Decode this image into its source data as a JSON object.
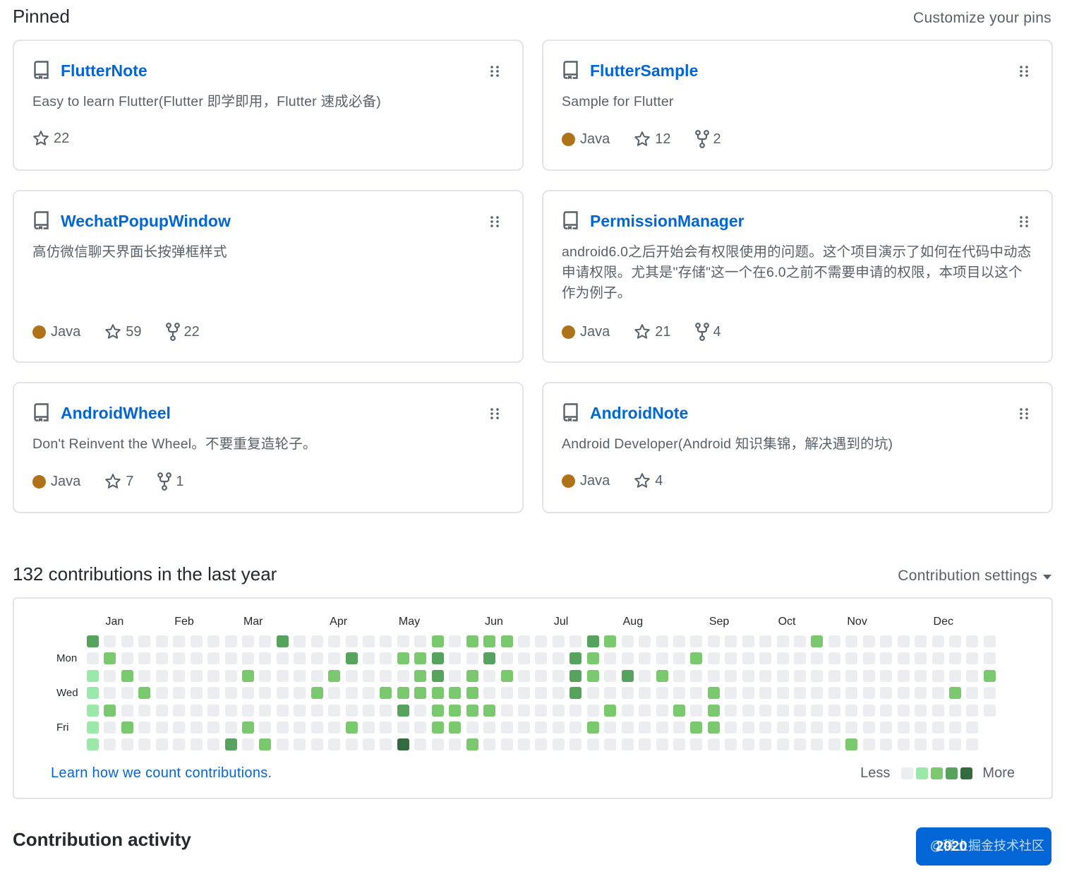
{
  "pinned": {
    "title": "Pinned",
    "customize_label": "Customize your pins",
    "cards": [
      {
        "name": "FlutterNote",
        "description": "Easy to learn Flutter(Flutter 即学即用，Flutter 速成必备)",
        "language": "",
        "stars": "22",
        "forks": ""
      },
      {
        "name": "FlutterSample",
        "description": "Sample for Flutter",
        "language": "Java",
        "stars": "12",
        "forks": "2"
      },
      {
        "name": "WechatPopupWindow",
        "description": "高仿微信聊天界面长按弹框样式",
        "language": "Java",
        "stars": "59",
        "forks": "22"
      },
      {
        "name": "PermissionManager",
        "description": "android6.0之后开始会有权限使用的问题。这个项目演示了如何在代码中动态申请权限。尤其是\"存储\"这一个在6.0之前不需要申请的权限，本项目以这个作为例子。",
        "language": "Java",
        "stars": "21",
        "forks": "4"
      },
      {
        "name": "AndroidWheel",
        "description": "Don't Reinvent the Wheel。不要重复造轮子。",
        "language": "Java",
        "stars": "7",
        "forks": "1"
      },
      {
        "name": "AndroidNote",
        "description": "Android Developer(Android 知识集锦，解决遇到的坑)",
        "language": "Java",
        "stars": "4",
        "forks": ""
      }
    ]
  },
  "contributions": {
    "title": "132 contributions in the last year",
    "settings_label": "Contribution settings",
    "months": [
      "Jan",
      "Feb",
      "Mar",
      "Apr",
      "May",
      "Jun",
      "Jul",
      "Aug",
      "Sep",
      "Oct",
      "Nov",
      "Dec"
    ],
    "days": [
      "Mon",
      "Wed",
      "Fri"
    ],
    "learn_label": "Learn how we count contributions.",
    "legend_less": "Less",
    "legend_more": "More",
    "level_colors": [
      "#ebedf0",
      "#9be9a8",
      "#7bc96f",
      "#56a35d",
      "#336b3e"
    ],
    "grid": [
      [
        3,
        0,
        1,
        1,
        1,
        1,
        1
      ],
      [
        0,
        2,
        0,
        0,
        2,
        0,
        0
      ],
      [
        0,
        0,
        2,
        0,
        0,
        2,
        0
      ],
      [
        0,
        0,
        0,
        2,
        0,
        0,
        0
      ],
      [
        0,
        0,
        0,
        0,
        0,
        0,
        0
      ],
      [
        0,
        0,
        0,
        0,
        0,
        0,
        0
      ],
      [
        0,
        0,
        0,
        0,
        0,
        0,
        0
      ],
      [
        0,
        0,
        0,
        0,
        0,
        0,
        0
      ],
      [
        0,
        0,
        0,
        0,
        0,
        0,
        3
      ],
      [
        0,
        0,
        2,
        0,
        0,
        2,
        0
      ],
      [
        0,
        0,
        0,
        0,
        0,
        0,
        2
      ],
      [
        3,
        0,
        0,
        0,
        0,
        0,
        0
      ],
      [
        0,
        0,
        0,
        0,
        0,
        0,
        0
      ],
      [
        0,
        0,
        0,
        2,
        0,
        0,
        0
      ],
      [
        0,
        0,
        2,
        0,
        0,
        0,
        0
      ],
      [
        0,
        3,
        0,
        0,
        0,
        2,
        0
      ],
      [
        0,
        0,
        0,
        0,
        0,
        0,
        0
      ],
      [
        0,
        0,
        0,
        2,
        0,
        0,
        0
      ],
      [
        0,
        2,
        0,
        2,
        3,
        0,
        4
      ],
      [
        0,
        2,
        2,
        2,
        0,
        0,
        0
      ],
      [
        2,
        3,
        3,
        2,
        2,
        2,
        0
      ],
      [
        0,
        0,
        0,
        2,
        2,
        2,
        0
      ],
      [
        2,
        0,
        2,
        2,
        2,
        0,
        2
      ],
      [
        2,
        3,
        0,
        0,
        2,
        0,
        0
      ],
      [
        2,
        0,
        2,
        0,
        0,
        0,
        0
      ],
      [
        0,
        0,
        0,
        0,
        0,
        0,
        0
      ],
      [
        0,
        0,
        0,
        0,
        0,
        0,
        0
      ],
      [
        0,
        0,
        0,
        0,
        0,
        0,
        0
      ],
      [
        0,
        3,
        3,
        3,
        0,
        0,
        0
      ],
      [
        3,
        2,
        2,
        0,
        0,
        2,
        0
      ],
      [
        2,
        0,
        0,
        0,
        2,
        0,
        0
      ],
      [
        0,
        0,
        3,
        0,
        0,
        0,
        0
      ],
      [
        0,
        0,
        0,
        0,
        0,
        0,
        0
      ],
      [
        0,
        0,
        2,
        0,
        0,
        0,
        0
      ],
      [
        0,
        0,
        0,
        0,
        2,
        0,
        0
      ],
      [
        0,
        2,
        0,
        0,
        0,
        2,
        0
      ],
      [
        0,
        0,
        0,
        2,
        2,
        2,
        0
      ],
      [
        0,
        0,
        0,
        0,
        0,
        0,
        0
      ],
      [
        0,
        0,
        0,
        0,
        0,
        0,
        0
      ],
      [
        0,
        0,
        0,
        0,
        0,
        0,
        0
      ],
      [
        0,
        0,
        0,
        0,
        0,
        0,
        0
      ],
      [
        0,
        0,
        0,
        0,
        0,
        0,
        0
      ],
      [
        2,
        0,
        0,
        0,
        0,
        0,
        0
      ],
      [
        0,
        0,
        0,
        0,
        0,
        0,
        0
      ],
      [
        0,
        0,
        0,
        0,
        0,
        0,
        2
      ],
      [
        0,
        0,
        0,
        0,
        0,
        0,
        0
      ],
      [
        0,
        0,
        0,
        0,
        0,
        0,
        0
      ],
      [
        0,
        0,
        0,
        0,
        0,
        0,
        0
      ],
      [
        0,
        0,
        0,
        0,
        0,
        0,
        0
      ],
      [
        0,
        0,
        0,
        0,
        0,
        0,
        0
      ],
      [
        0,
        0,
        0,
        2,
        0,
        0,
        0
      ],
      [
        0,
        0,
        0,
        0,
        0,
        0,
        0
      ],
      [
        0,
        0,
        2,
        0,
        0,
        0,
        0
      ]
    ]
  },
  "activity": {
    "title": "Contribution activity",
    "year_label": "2020",
    "watermark": "@稀土掘金技术社区"
  }
}
